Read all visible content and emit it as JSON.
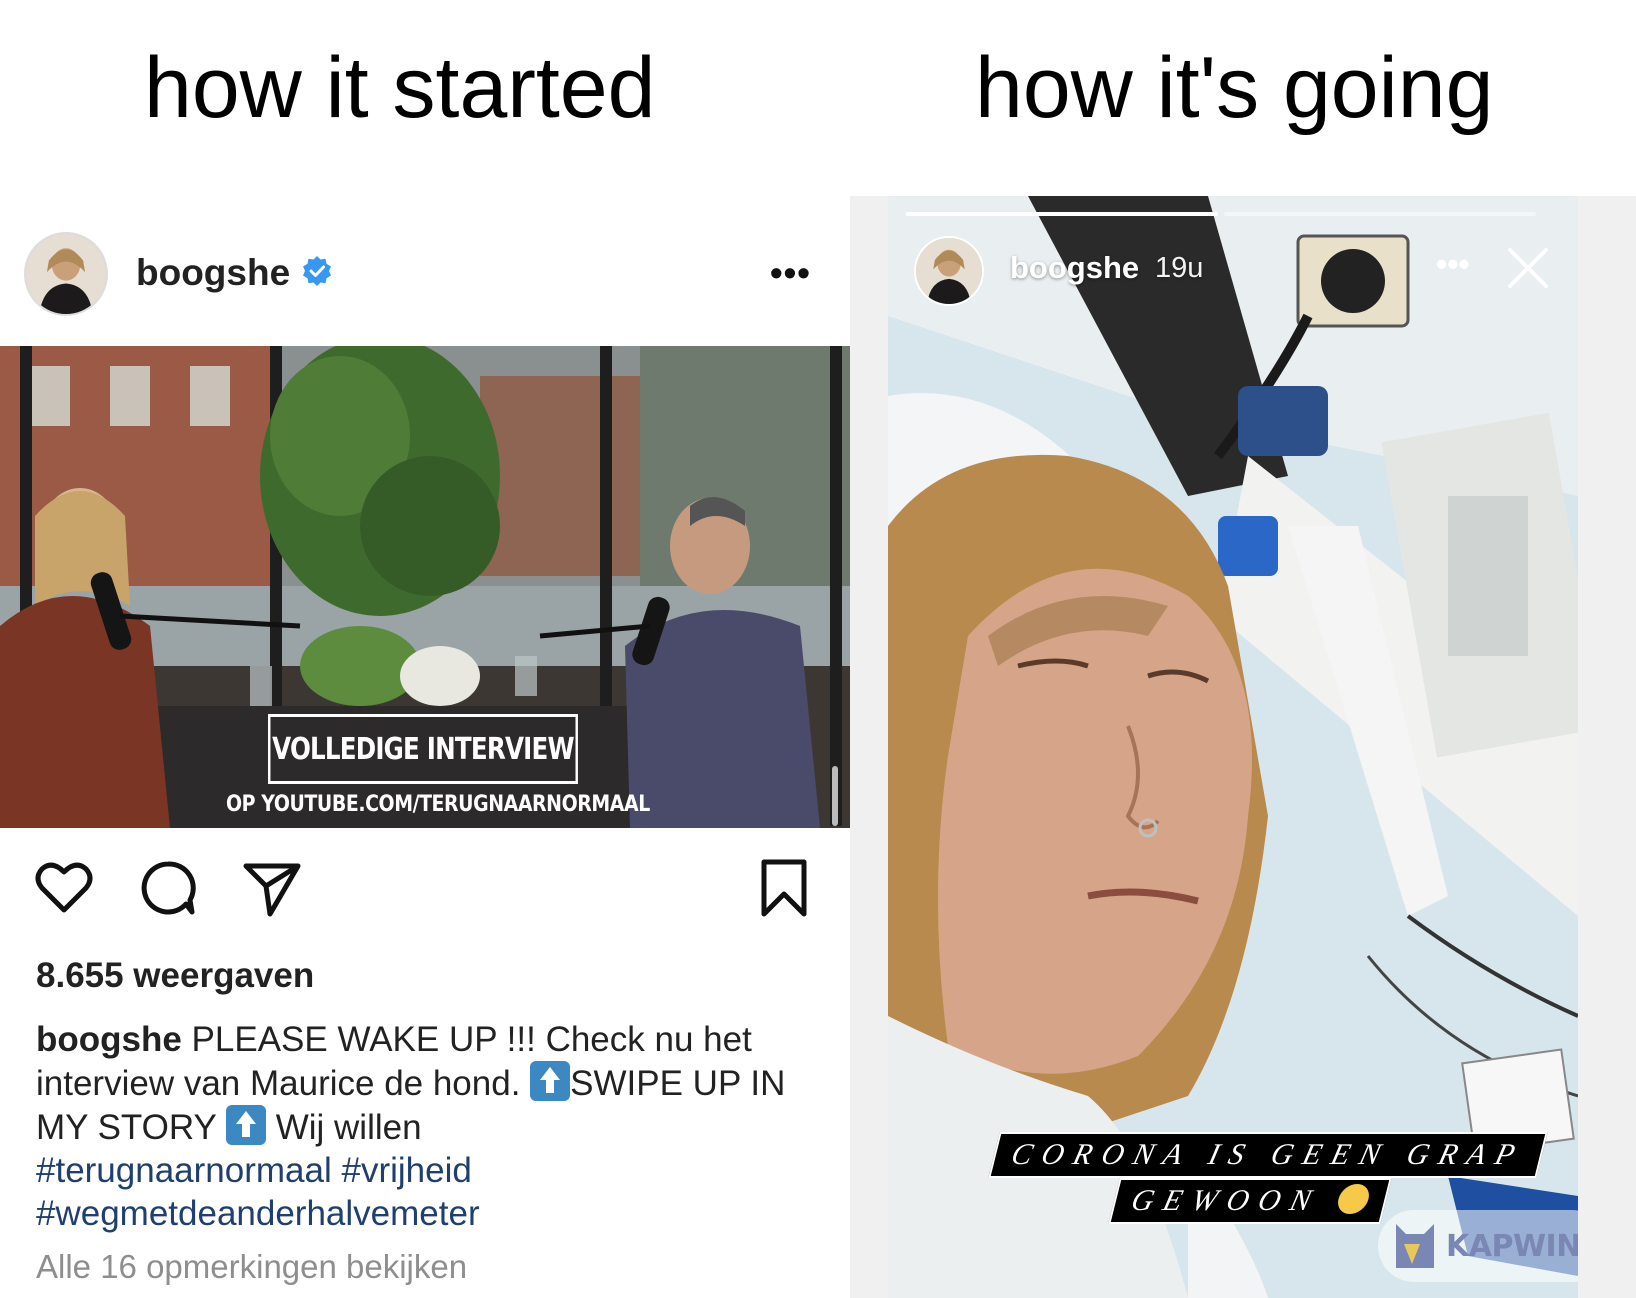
{
  "meme": {
    "left_title": "how it started",
    "right_title": "how it's going"
  },
  "post": {
    "username": "boogshe",
    "verified": true,
    "menu_icon": "more-dots-icon",
    "video": {
      "overlay_title": "VOLLEDIGE INTERVIEW",
      "overlay_subtitle": "OP YOUTUBE.COM/TERUGNAARNORMAAL"
    },
    "actions": [
      "heart-icon",
      "comment-icon",
      "share-icon",
      "bookmark-icon"
    ],
    "views": "8.655 weergaven",
    "caption": {
      "username": "boogshe",
      "part1": " PLEASE WAKE UP !!! Check nu het interview van Maurice de hond. ",
      "part2": "SWIPE UP IN MY STORY ",
      "part3": " Wij willen ",
      "hashtag1": "#terugnaarnormaal",
      "hashtag2": "#vrijheid",
      "hashtag3": "#wegmetdeanderhalvemeter"
    },
    "comments_link": "Alle 16 opmerkingen bekijken"
  },
  "story": {
    "username": "boogshe",
    "time": "19u",
    "more_icon": "more-dots-icon",
    "close_icon": "close-icon",
    "progress": [
      0.66,
      0.0
    ],
    "sticker_line1": "CORONA IS GEEN GRAP",
    "sticker_line2": "GEWOON",
    "watermark": "KAPWING"
  },
  "colors": {
    "verified_blue": "#3897f0",
    "hashtag_blue": "#1f3f6e",
    "muted_gray": "#8e8e8e"
  }
}
